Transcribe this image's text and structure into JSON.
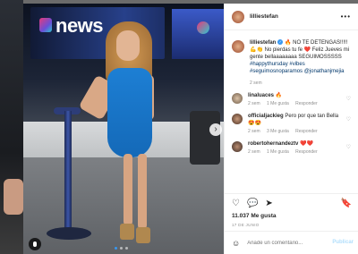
{
  "photo": {
    "screen_text": "news",
    "next_icon": "›"
  },
  "post": {
    "username": "lilliestefan",
    "verified_mark": "✓",
    "more_icon": "•••",
    "caption_user": "lilliestefan",
    "caption_text": " 🔥 NO TE DETENGAS!!!!! 💪👏 No pierdas tu fe ❤️ Feliz Jueves mi gente bellaaaaaaaa SEGUIMOSSSSS",
    "hashtags": " #happythursday #vibes #seguimosnoparamos",
    "mention": " @jonathanjmejia",
    "time": "2 sem"
  },
  "comments": [
    {
      "user": "linaluaces",
      "text": " 🔥",
      "meta_time": "2 sem",
      "meta_likes": "1 Me gusta",
      "reply": "Responder"
    },
    {
      "user": "officialjackieg",
      "text": " Pero por que tan Bella 😍😍",
      "meta_time": "2 sem",
      "meta_likes": "3 Me gusta",
      "reply": "Responder"
    },
    {
      "user": "robertohernandeztv",
      "text": " ❤️❤️",
      "meta_time": "2 sem",
      "meta_likes": "1 Me gusta",
      "reply": "Responder"
    }
  ],
  "icons": {
    "heart": "♡",
    "comment": "💬",
    "share": "➤",
    "bookmark": "🔖",
    "smile": "☺"
  },
  "likes": "11.037 Me gusta",
  "date": "17 DE JUNIO",
  "add_comment": {
    "placeholder": "Añade un comentario...",
    "publish": "Publicar"
  }
}
